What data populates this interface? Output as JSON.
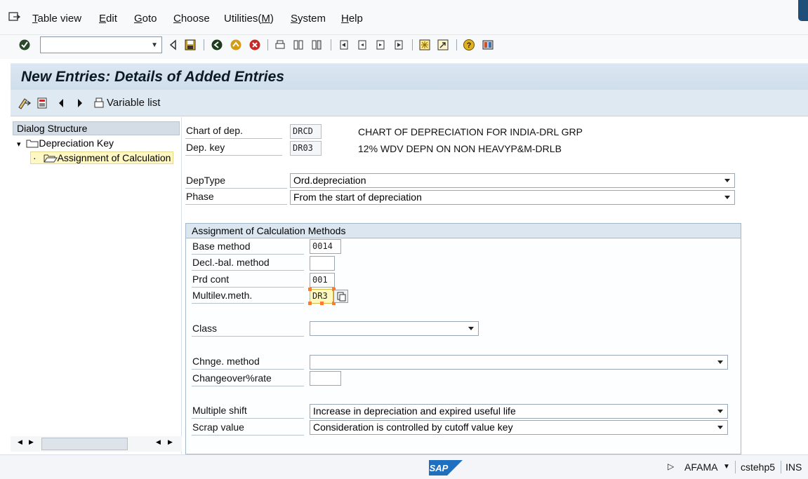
{
  "menu": {
    "items": [
      {
        "label": "Table view",
        "underline": "T"
      },
      {
        "label": "Edit",
        "underline": "E"
      },
      {
        "label": "Goto",
        "underline": "G"
      },
      {
        "label": "Choose",
        "underline": "C"
      },
      {
        "label": "Utilities(M)",
        "underline": "M"
      },
      {
        "label": "System",
        "underline": "S"
      },
      {
        "label": "Help",
        "underline": "H"
      }
    ]
  },
  "toolbar": {
    "command_value": "",
    "icons": [
      "enter-check-icon",
      "back-icon",
      "save-icon",
      "back-green-icon",
      "exit-icon",
      "cancel-icon",
      "print-icon",
      "find-icon",
      "find-next-icon",
      "first-page-icon",
      "previous-page-icon",
      "next-page-icon",
      "last-page-icon",
      "create-session-icon",
      "shortcut-icon",
      "help-icon",
      "layout-menu-icon"
    ]
  },
  "screen": {
    "title": "New Entries: Details of Added Entries",
    "app_toolbar": {
      "variable_list_label": "Variable list"
    }
  },
  "tree": {
    "header": "Dialog Structure",
    "nodes": [
      {
        "label": "Depreciation Key",
        "bullet": "▾"
      },
      {
        "label": "Assignment of Calculation",
        "bullet": "·"
      }
    ]
  },
  "form": {
    "chart_of_dep": {
      "label": "Chart of dep.",
      "value": "DRCD",
      "description": "CHART OF DEPRECIATION FOR INDIA-DRL GRP"
    },
    "dep_key": {
      "label": "Dep. key",
      "value": "DR03",
      "description": "12% WDV DEPN ON NON HEAVYP&M-DRLB"
    },
    "dep_type": {
      "label": "DepType",
      "value": "Ord.depreciation"
    },
    "phase": {
      "label": "Phase",
      "value": "From the start of depreciation"
    }
  },
  "group": {
    "title": "Assignment of Calculation Methods",
    "base_method": {
      "label": "Base method",
      "value": "0014"
    },
    "decl_bal_method": {
      "label": "Decl.-bal. method",
      "value": ""
    },
    "prd_cont": {
      "label": "Prd cont",
      "value": "001"
    },
    "multilev_meth": {
      "label": "Multilev.meth.",
      "value": "DR3"
    },
    "class": {
      "label": "Class",
      "value": ""
    },
    "chnge_method": {
      "label": "Chnge. method",
      "value": ""
    },
    "changeover_rate": {
      "label": "Changeover%rate",
      "value": ""
    },
    "multiple_shift": {
      "label": "Multiple shift",
      "value": "Increase in depreciation and expired useful life"
    },
    "scrap_value": {
      "label": "Scrap value",
      "value": "Consideration is controlled by cutoff value key"
    }
  },
  "status": {
    "logo": "SAP",
    "transaction": "AFAMA",
    "server": "cstehp5",
    "mode": "INS"
  },
  "colors": {
    "title_bg": "#dbe7f2",
    "highlight": "#fff8bf",
    "handle": "#ff7a2a",
    "sap_blue": "#1f6fbf"
  }
}
